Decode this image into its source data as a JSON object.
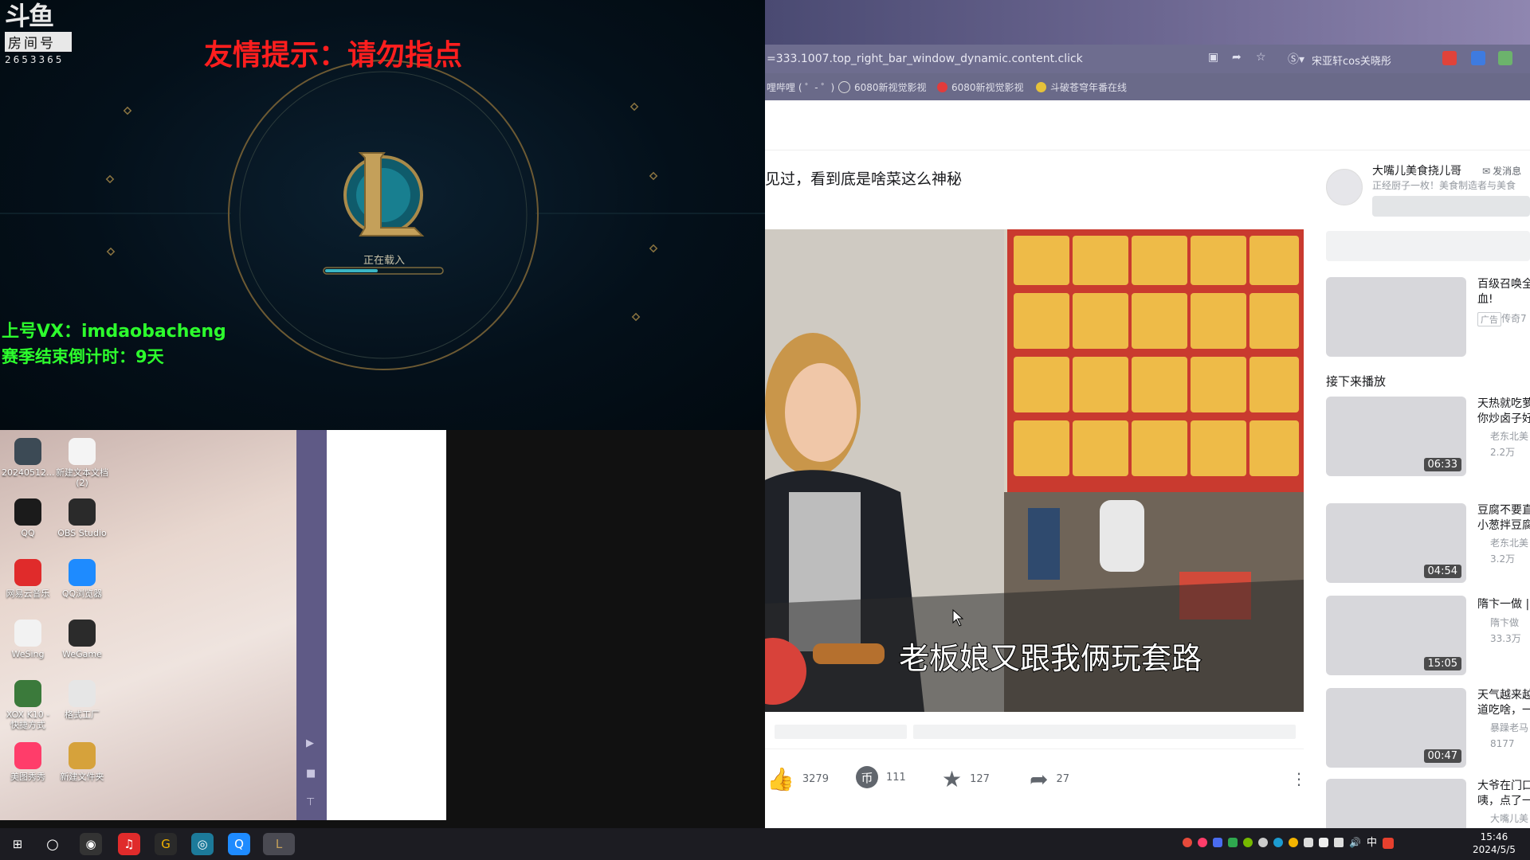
{
  "browser": {
    "address": "=333.1007.top_right_bar_window_dynamic.content.click",
    "address_right_text": "宋亚轩cos关晓彤",
    "bookmarks": [
      "哩哔哩 ( ゜- ゜)",
      "6080新视觉影视",
      "6080新视觉影视",
      "斗破苍穹年番在线"
    ],
    "video_title": "见过，看到底是啥菜这么神秘",
    "subtitle": "老板娘又跟我俩玩套路",
    "stats": {
      "likes": "3279",
      "coins": "111",
      "favorites": "127",
      "shares": "27"
    },
    "uploader": {
      "name": "大嘴儿美食挠儿哥",
      "message": "发消息",
      "bio": "正经厨子一枚！美食制造者与美食"
    },
    "ad": {
      "title": "百级召唤全",
      "title2": "血!",
      "tag": "广告",
      "meta": "传奇7"
    },
    "up_next": "接下来播放",
    "recommendations": [
      {
        "title1": "天热就吃萝",
        "title2": "你炒卤子好",
        "author": "老东北美",
        "views": "2.2万",
        "duration": "06:33"
      },
      {
        "title1": "豆腐不要直",
        "title2": "小葱拌豆腐",
        "author": "老东北美",
        "views": "3.2万",
        "duration": "04:54"
      },
      {
        "title1": "隋卞一做 |",
        "title2": "",
        "author": "隋卞做",
        "views": "33.3万",
        "duration": "15:05"
      },
      {
        "title1": "天气越来越",
        "title2": "道吃啥，一",
        "author": "暴躁老马",
        "views": "8177",
        "duration": "00:47"
      },
      {
        "title1": "大爷在门口",
        "title2": "咦，点了一",
        "author": "大嘴儿美",
        "views": "",
        "duration": ""
      }
    ]
  },
  "stream": {
    "logo": "斗鱼",
    "room_label": "房间号",
    "room_number": "2653365",
    "notice": "友情提示：请勿指点",
    "vx": "上号VX：imdaobacheng",
    "countdown": "赛季结束倒计时：9天",
    "loading": "正在载入",
    "loading_progress": 0.45
  },
  "desktop": {
    "icons": [
      {
        "label": "20240512...",
        "name": "screenshot-file-icon",
        "color": "#3c4a55"
      },
      {
        "label": "新建文本文档 (2)",
        "name": "text-document-icon",
        "color": "#f4f4f4"
      },
      {
        "label": "QQ",
        "name": "qq-icon",
        "color": "#1b1b1b"
      },
      {
        "label": "OBS Studio",
        "name": "obs-icon",
        "color": "#2a2a2a"
      },
      {
        "label": "网易云音乐",
        "name": "netease-music-icon",
        "color": "#e02b2b"
      },
      {
        "label": "QQ浏览器",
        "name": "qq-browser-icon",
        "color": "#1e8bff"
      },
      {
        "label": "WeSing",
        "name": "wesing-icon",
        "color": "#f2f2f2"
      },
      {
        "label": "WeGame",
        "name": "wegame-icon",
        "color": "#2b2b2b"
      },
      {
        "label": "XOX K10 - 快捷方式",
        "name": "xox-shortcut-icon",
        "color": "#3b7a3b"
      },
      {
        "label": "格式工厂",
        "name": "format-factory-icon",
        "color": "#e6e6e6"
      },
      {
        "label": "美图秀秀",
        "name": "meitu-icon",
        "color": "#ff3d6a"
      },
      {
        "label": "新建文件夹",
        "name": "new-folder-icon",
        "color": "#d6a23b"
      }
    ]
  },
  "taskbar": {
    "time": "15:46",
    "date": "2024/5/5",
    "ime": "中"
  }
}
